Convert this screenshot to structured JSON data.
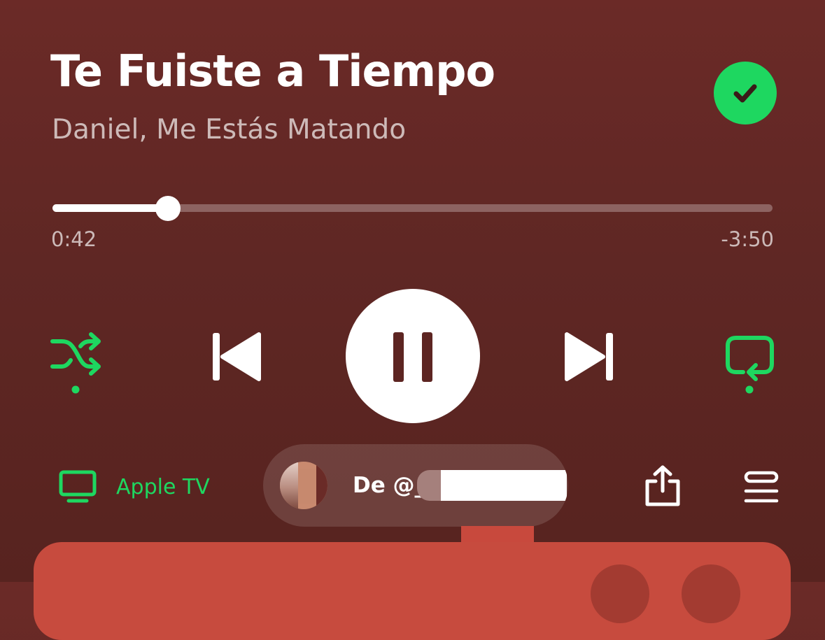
{
  "track": {
    "title": "Te Fuiste a Tiempo",
    "artist": "Daniel, Me Estás Matando",
    "liked": true
  },
  "progress": {
    "elapsed": "0:42",
    "remaining": "-3:50",
    "fraction": 0.16
  },
  "controls": {
    "shuffle_active": true,
    "repeat_active": true,
    "state": "playing"
  },
  "device": {
    "label": "Apple TV"
  },
  "jam": {
    "text": "De @_"
  },
  "colors": {
    "accent": "#1ed760",
    "background": "#652a26",
    "card": "#c74b3e"
  },
  "icons": {
    "liked": "check-circle-icon",
    "shuffle": "shuffle-icon",
    "previous": "skip-previous-icon",
    "pause": "pause-icon",
    "next": "skip-next-icon",
    "repeat": "repeat-icon",
    "device": "tv-icon",
    "share": "share-icon",
    "queue": "queue-icon"
  }
}
